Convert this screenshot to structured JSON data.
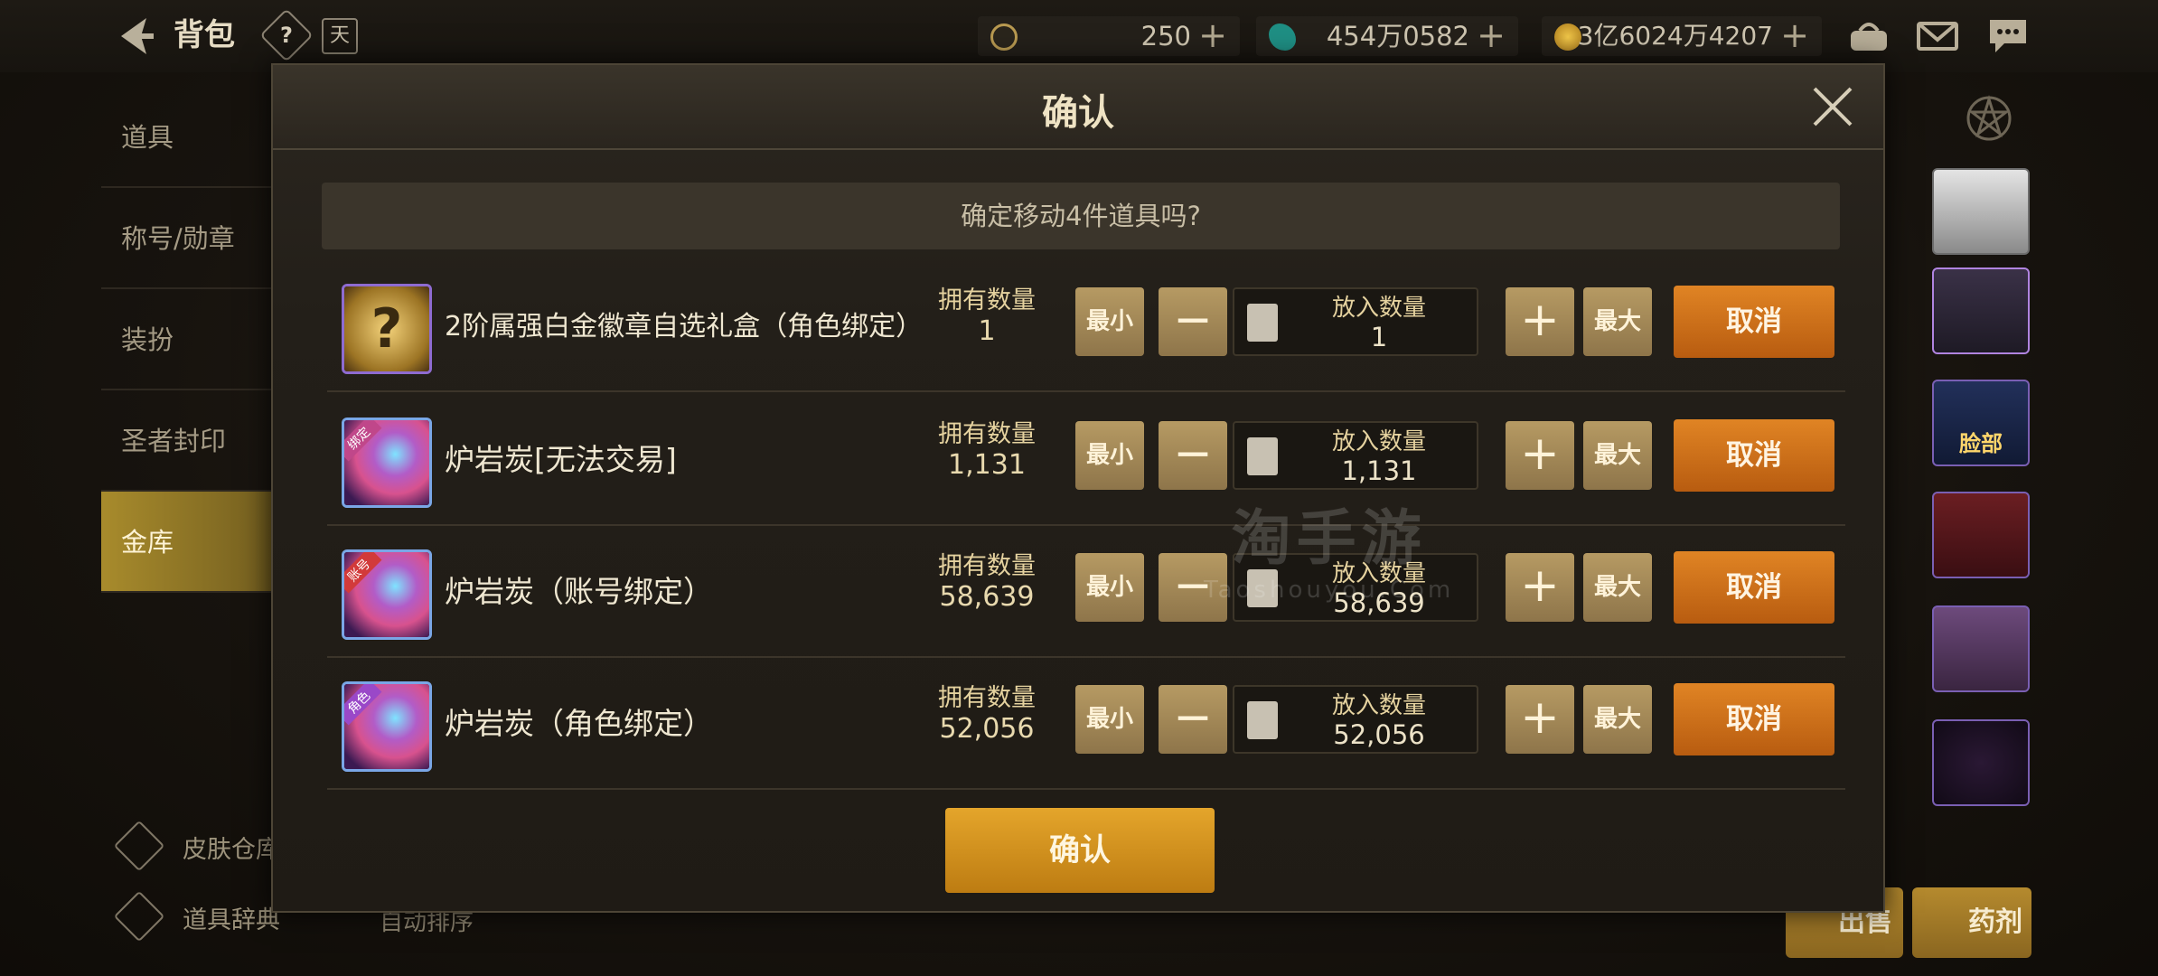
{
  "topbar": {
    "title": "背包",
    "help_icon_glyph": "?",
    "calendar_icon_glyph": "天",
    "currencies": [
      {
        "name": "ceras",
        "value": "250",
        "plus": "+",
        "color": "#d4b25b"
      },
      {
        "name": "gem",
        "value": "454万0582",
        "plus": "+",
        "color": "#2fb8a2"
      },
      {
        "name": "gold",
        "value": "3亿6024万4207",
        "plus": "+",
        "color": "#d9a623"
      }
    ]
  },
  "sidebar": {
    "items": [
      {
        "label": "道具"
      },
      {
        "label": "称号/勋章"
      },
      {
        "label": "装扮"
      },
      {
        "label": "圣者封印"
      },
      {
        "label": "金库"
      }
    ],
    "extras": [
      {
        "label": "皮肤仓库"
      },
      {
        "label": "道具辞典"
      }
    ],
    "auto_sort": "自动排序"
  },
  "background": {
    "bg_item_label": "脸部",
    "sell_button": "出售",
    "potion_button": "药剂"
  },
  "modal": {
    "title": "确认",
    "prompt": "确定移动4件道具吗?",
    "owned_label": "拥有数量",
    "put_label": "放入数量",
    "min_label": "最小",
    "max_label": "最大",
    "minus": "−",
    "plus": "+",
    "cancel_label": "取消",
    "confirm_label": "确认",
    "items": [
      {
        "name": "2阶属强白金徽章自选礼盒（角色绑定）",
        "owned": "1",
        "put": "1",
        "badge": ""
      },
      {
        "name": "炉岩炭[无法交易]",
        "owned": "1,131",
        "put": "1,131",
        "badge": "绑定"
      },
      {
        "name": "炉岩炭（账号绑定）",
        "owned": "58,639",
        "put": "58,639",
        "badge": "账号"
      },
      {
        "name": "炉岩炭（角色绑定）",
        "owned": "52,056",
        "put": "52,056",
        "badge": "角色"
      }
    ]
  },
  "watermark": {
    "main": "淘手游",
    "sub": "Taoshouyou.Com"
  }
}
